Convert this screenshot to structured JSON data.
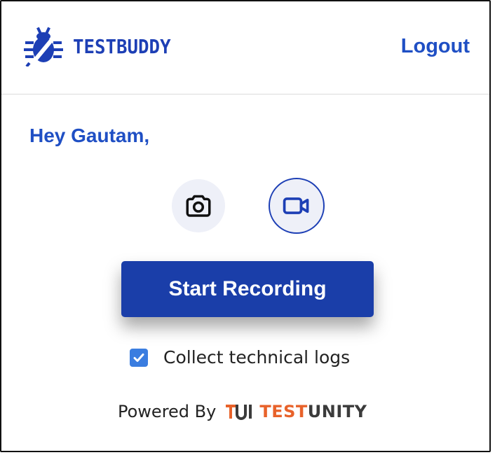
{
  "header": {
    "brand_name": "TESTBUDDY",
    "logo_icon": "bug-icon",
    "logout_label": "Logout"
  },
  "main": {
    "greeting": "Hey Gautam,",
    "modes": [
      {
        "name": "screenshot",
        "icon": "camera-icon",
        "selected": false
      },
      {
        "name": "video",
        "icon": "video-camera-icon",
        "selected": true
      }
    ],
    "start_button_label": "Start Recording",
    "collect_logs": {
      "label": "Collect technical logs",
      "checked": true
    }
  },
  "footer": {
    "powered_by_label": "Powered By",
    "partner_brand_part1": "TEST",
    "partner_brand_part2": "UNITY"
  },
  "colors": {
    "brand_blue": "#1d3fb5",
    "link_blue": "#1f4fc4",
    "button_blue": "#1a3ea9",
    "checkbox_blue": "#3a7de0",
    "partner_orange": "#e8622a"
  }
}
